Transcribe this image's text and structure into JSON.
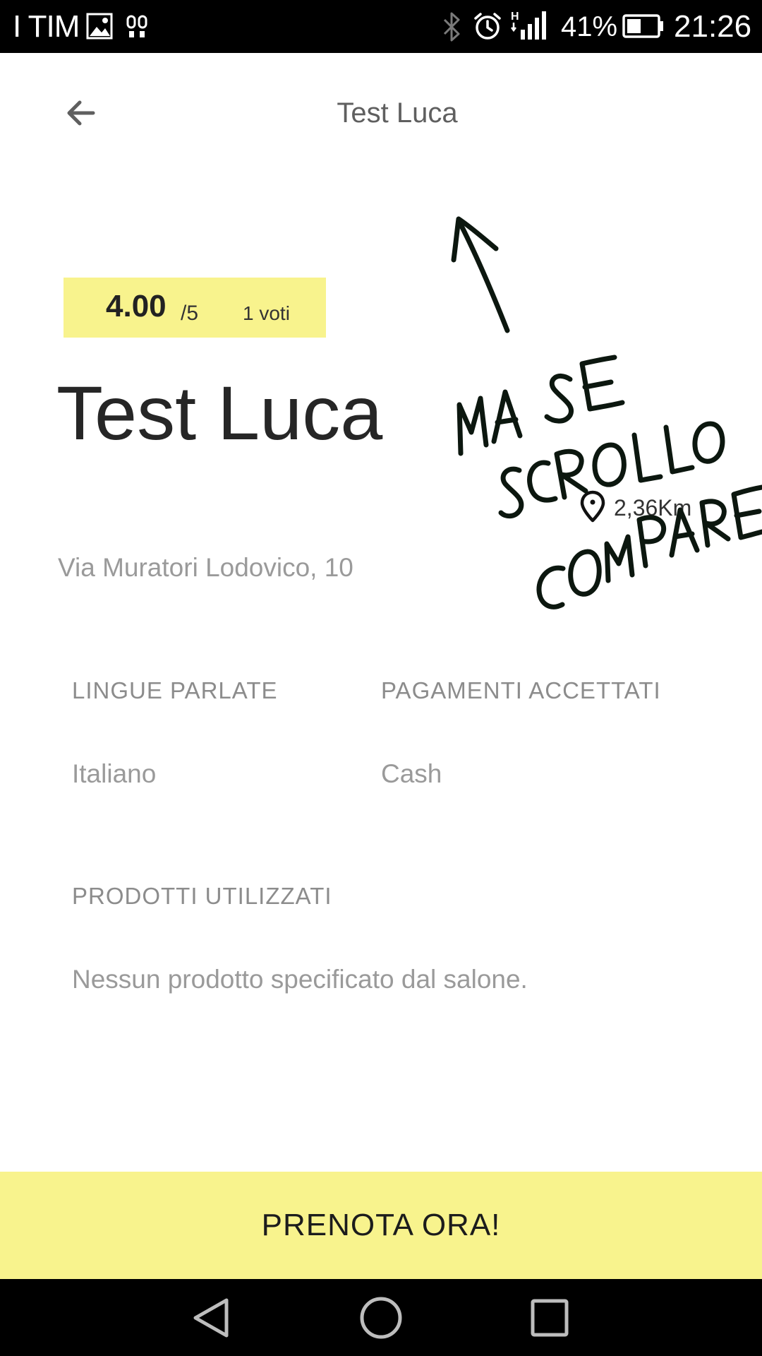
{
  "status_bar": {
    "carrier": "I TIM",
    "battery_percent": "41%",
    "time": "21:26",
    "icons": [
      "gallery-icon",
      "voicemail-icon",
      "bluetooth-icon",
      "alarm-icon",
      "signal-icon",
      "battery-icon"
    ]
  },
  "app_bar": {
    "title": "Test Luca",
    "back_icon": "arrow-left-icon"
  },
  "rating": {
    "score": "4.00",
    "max": "/5",
    "votes": "1 voti",
    "background_color": "#f8f38d"
  },
  "salon": {
    "name": "Test Luca",
    "address": "Via Muratori Lodovico, 10",
    "distance": "2,36Km",
    "distance_icon": "map-pin-icon"
  },
  "languages": {
    "label": "LINGUE PARLATE",
    "value": "Italiano"
  },
  "payments": {
    "label": "PAGAMENTI ACCETTATI",
    "value": "Cash"
  },
  "products": {
    "label": "PRODOTTI UTILIZZATI",
    "value": "Nessun prodotto specificato dal salone."
  },
  "annotation": {
    "lines": [
      "MA SE",
      "SCROLLO",
      "COMPARE"
    ],
    "icon": "hand-drawn-arrow-up-icon"
  },
  "book_button": {
    "label": "PRENOTA ORA!",
    "background_color": "#f8f38d"
  },
  "nav_bar": {
    "icons": [
      "nav-back-icon",
      "nav-home-icon",
      "nav-recents-icon"
    ]
  }
}
